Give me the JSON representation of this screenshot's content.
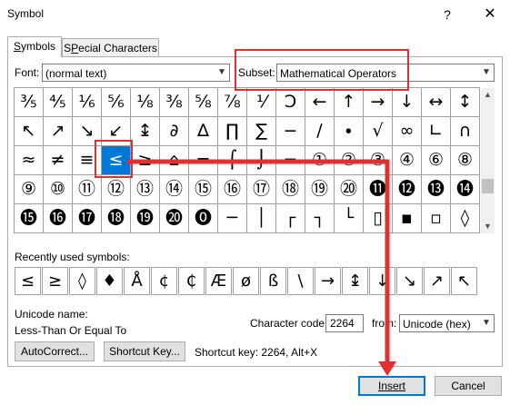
{
  "window": {
    "title": "Symbol",
    "help_label": "?",
    "close_label": "✕"
  },
  "tabs": [
    {
      "label": "Symbols",
      "underline": "S",
      "rest": "ymbols"
    },
    {
      "label": "Special Characters",
      "underline": "P",
      "rest": "ecial Characters",
      "prefix": "S"
    }
  ],
  "font": {
    "label": "Font:",
    "value": "(normal text)"
  },
  "subset": {
    "label": "Subset:",
    "value": "Mathematical Operators"
  },
  "grid": {
    "rows": [
      [
        "⅗",
        "⅘",
        "⅙",
        "⅚",
        "⅛",
        "⅜",
        "⅝",
        "⅞",
        "⅟",
        "Ↄ",
        "←",
        "↑",
        "→",
        "↓",
        "↔",
        "↕"
      ],
      [
        "↖",
        "↗",
        "↘",
        "↙",
        "↨",
        "∂",
        "∆",
        "∏",
        "∑",
        "−",
        "∕",
        "∙",
        "√",
        "∞",
        "∟",
        "∩"
      ],
      [
        "≈",
        "≠",
        "≡",
        "≤",
        "≥",
        "⌂",
        "⌐",
        "⌠",
        "⌡",
        "─",
        "①",
        "②",
        "③",
        "④",
        "⑥",
        "⑧"
      ],
      [
        "⑨",
        "⑩",
        "⑪",
        "⑫",
        "⑬",
        "⑭",
        "⑮",
        "⑯",
        "⑰",
        "⑱",
        "⑲",
        "⑳",
        "⓫",
        "⓬",
        "⓭",
        "⓮"
      ],
      [
        "⓯",
        "⓰",
        "⓱",
        "⓲",
        "⓳",
        "⓴",
        "⓿",
        "─",
        "│",
        "┌",
        "┐",
        "└",
        "▯",
        "▪",
        "▫",
        "◊"
      ]
    ],
    "selected_row": 2,
    "selected_col": 3
  },
  "recent": {
    "label": "Recently used symbols:",
    "items": [
      "≤",
      "≥",
      "◊",
      "♦",
      "Å",
      "¢",
      "₵",
      "Æ",
      "ø",
      "ß",
      "\\",
      "→",
      "↨",
      "↓",
      "↘",
      "↗",
      "↖"
    ]
  },
  "unicode_name": {
    "label": "Unicode name:",
    "value": "Less-Than Or Equal To"
  },
  "character_code": {
    "label": "Character code:",
    "value": "2264"
  },
  "from": {
    "label": "from:",
    "value": "Unicode (hex)"
  },
  "buttons": {
    "autocorrect": "AutoCorrect...",
    "shortcut_key": "Shortcut Key...",
    "insert": "Insert",
    "cancel": "Cancel"
  },
  "shortcut_text": "Shortcut key: 2264, Alt+X",
  "colors": {
    "accent": "#0078d7",
    "annotation_red": "#e03030"
  }
}
